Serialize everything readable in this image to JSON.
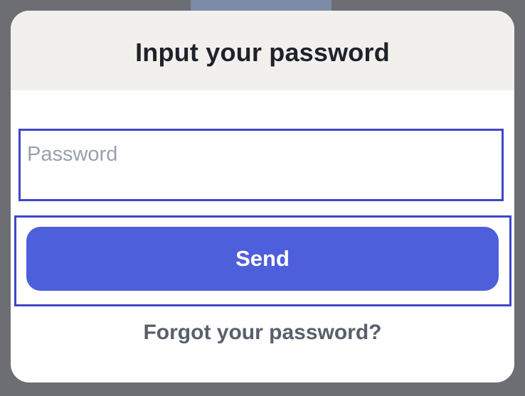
{
  "dialog": {
    "title": "Input your password",
    "password_field": {
      "placeholder": "Password",
      "value": ""
    },
    "send_label": "Send",
    "forgot_link": "Forgot your password?"
  },
  "colors": {
    "accent": "#4e5fdc",
    "highlight_border": "#3f47c8",
    "header_bg": "#f2f0ed",
    "overlay_bg": "#6d6e74"
  }
}
